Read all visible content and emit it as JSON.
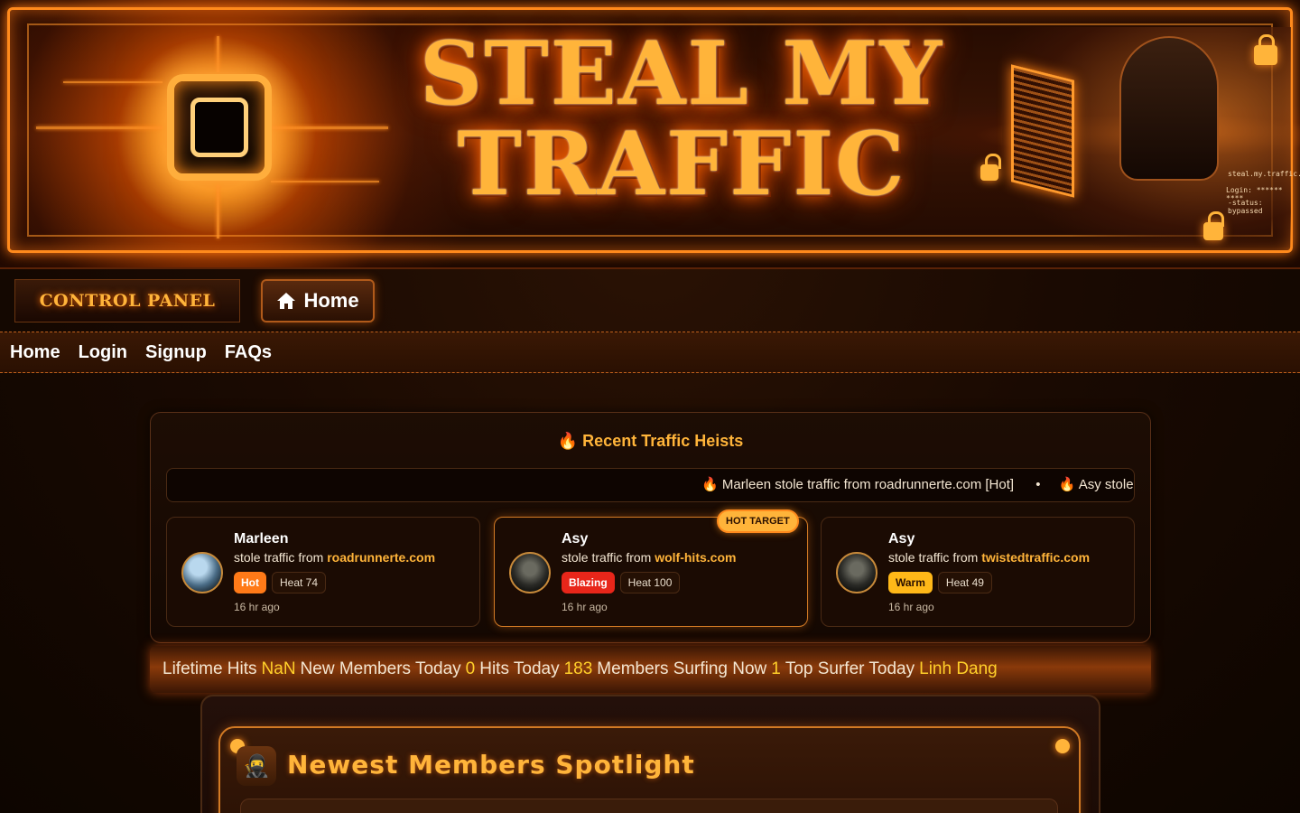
{
  "banner": {
    "title_line1": "STEAL MY",
    "title_line2": "TRAFFIC",
    "code_lines": [
      "steal.my.traffic.exe",
      "Login: ****** ****",
      "-status: bypassed"
    ]
  },
  "controls": {
    "control_panel_label": "CONTROL PANEL",
    "home_button_label": "Home"
  },
  "nav": {
    "items": [
      "Home",
      "Login",
      "Signup",
      "FAQs"
    ]
  },
  "heists": {
    "title": "Recent Traffic Heists",
    "ticker": [
      "Marleen stole traffic from roadrunnerte.com [Hot]",
      "Asy stole tr"
    ],
    "ticker_sep": "•",
    "cards": [
      {
        "name": "Marleen",
        "prefix": "stole traffic from ",
        "site": "roadrunnerte.com",
        "badge": "Hot",
        "heat": "Heat 74",
        "time": "16 hr ago"
      },
      {
        "name": "Asy",
        "prefix": "stole traffic from ",
        "site": "wolf-hits.com",
        "badge": "Blazing",
        "heat": "Heat 100",
        "time": "16 hr ago",
        "tag": "HOT TARGET"
      },
      {
        "name": "Asy",
        "prefix": "stole traffic from ",
        "site": "twistedtraffic.com",
        "badge": "Warm",
        "heat": "Heat 49",
        "time": "16 hr ago"
      }
    ]
  },
  "stats": {
    "lifetime_label": "Lifetime Hits",
    "lifetime_value": "NaN",
    "new_members_label": "New Members Today",
    "new_members_value": "0",
    "hits_today_label": "Hits Today",
    "hits_today_value": "183",
    "surfing_label": "Members Surfing Now",
    "surfing_value": "1",
    "top_surfer_label": "Top Surfer Today",
    "top_surfer_value": "Linh Dang"
  },
  "spotlight": {
    "title": "Newest Members Spotlight",
    "icon": "ninja-icon"
  },
  "colors": {
    "accent": "#ffb43a",
    "stat_value": "#ffd02a",
    "hot": "#ff7a18",
    "blazing": "#e8261a",
    "warm": "#ffb818"
  }
}
